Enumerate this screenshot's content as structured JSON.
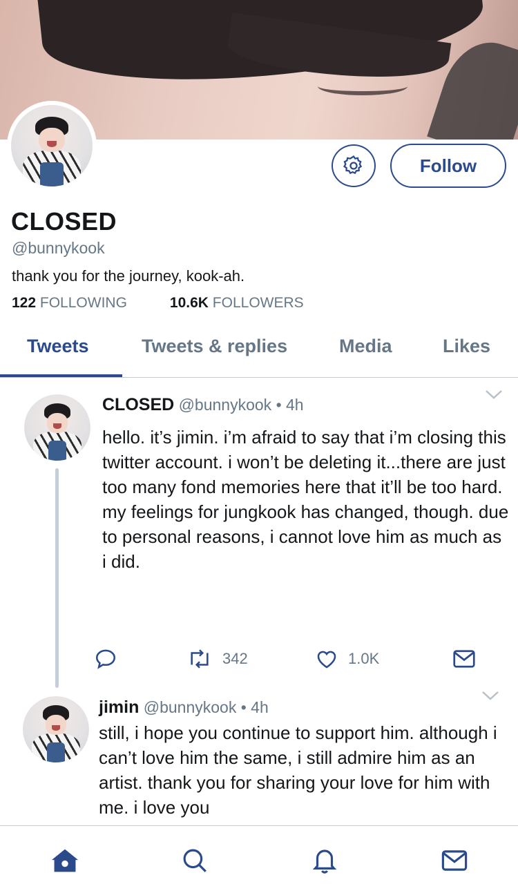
{
  "profile": {
    "display_name": "CLOSED",
    "handle": "@bunnykook",
    "bio": "thank you for the journey, kook-ah.",
    "following_count": "122",
    "following_label": "FOLLOWING",
    "followers_count": "10.6K",
    "followers_label": "FOLLOWERS",
    "follow_label": "Follow"
  },
  "tabs": [
    {
      "label": "Tweets",
      "active": true
    },
    {
      "label": "Tweets & replies",
      "active": false
    },
    {
      "label": "Media",
      "active": false
    },
    {
      "label": "Likes",
      "active": false
    }
  ],
  "tweets": [
    {
      "name": "CLOSED",
      "meta": "@bunnykook • 4h",
      "text": "hello. it’s jimin. i’m afraid to say that i’m closing this twitter account. i won’t be deleting it...there are just too many fond memories here that it’ll be too hard. my feelings for jungkook has changed, though. due to personal reasons, i cannot love him as much as i did.",
      "retweets": "342",
      "likes": "1.0K"
    },
    {
      "name": "jimin",
      "meta": "@bunnykook • 4h",
      "text": "still, i hope you continue to support him. although i can’t love him the same, i still admire him as an artist. thank you for sharing your love for him with me. i love you"
    }
  ],
  "icons": {
    "settings": "gear-icon",
    "reply": "reply-icon",
    "retweet": "retweet-icon",
    "like": "heart-icon",
    "dm": "envelope-icon",
    "nav_home": "home-icon",
    "nav_search": "search-icon",
    "nav_notifications": "bell-icon",
    "nav_messages": "mail-icon"
  },
  "colors": {
    "accent": "#2a4a8c",
    "muted": "#657786",
    "text": "#14171a"
  }
}
